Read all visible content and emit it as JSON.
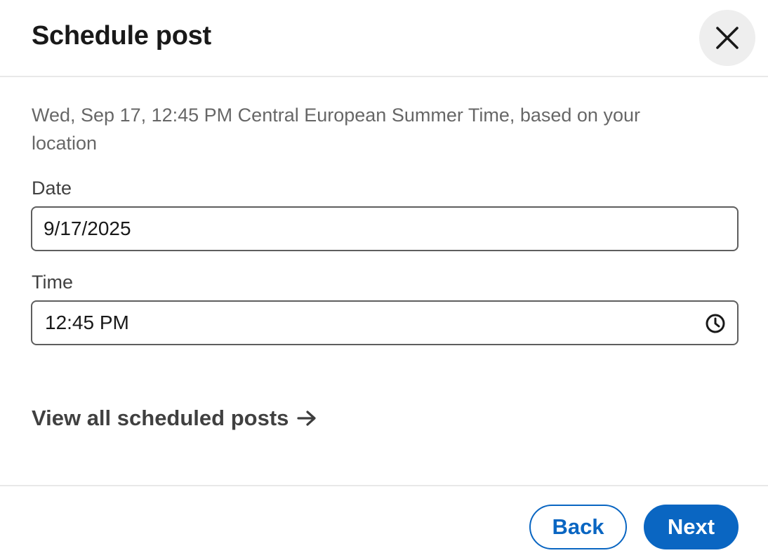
{
  "dialog": {
    "title": "Schedule post",
    "close_label": "Dismiss"
  },
  "timezone_note": "Wed, Sep 17, 12:45 PM Central European Summer Time, based on your location",
  "date_field": {
    "label": "Date",
    "value": "9/17/2025"
  },
  "time_field": {
    "label": "Time",
    "value": "12:45 PM",
    "icon": "clock-icon"
  },
  "view_all_link": {
    "label": "View all scheduled posts",
    "icon": "arrow-right-icon"
  },
  "footer": {
    "back_label": "Back",
    "next_label": "Next"
  },
  "colors": {
    "primary": "#0a66c2",
    "text": "#191919",
    "muted_text": "#666666",
    "divider": "#e8e8e8",
    "close_bg": "#eeeeee"
  }
}
